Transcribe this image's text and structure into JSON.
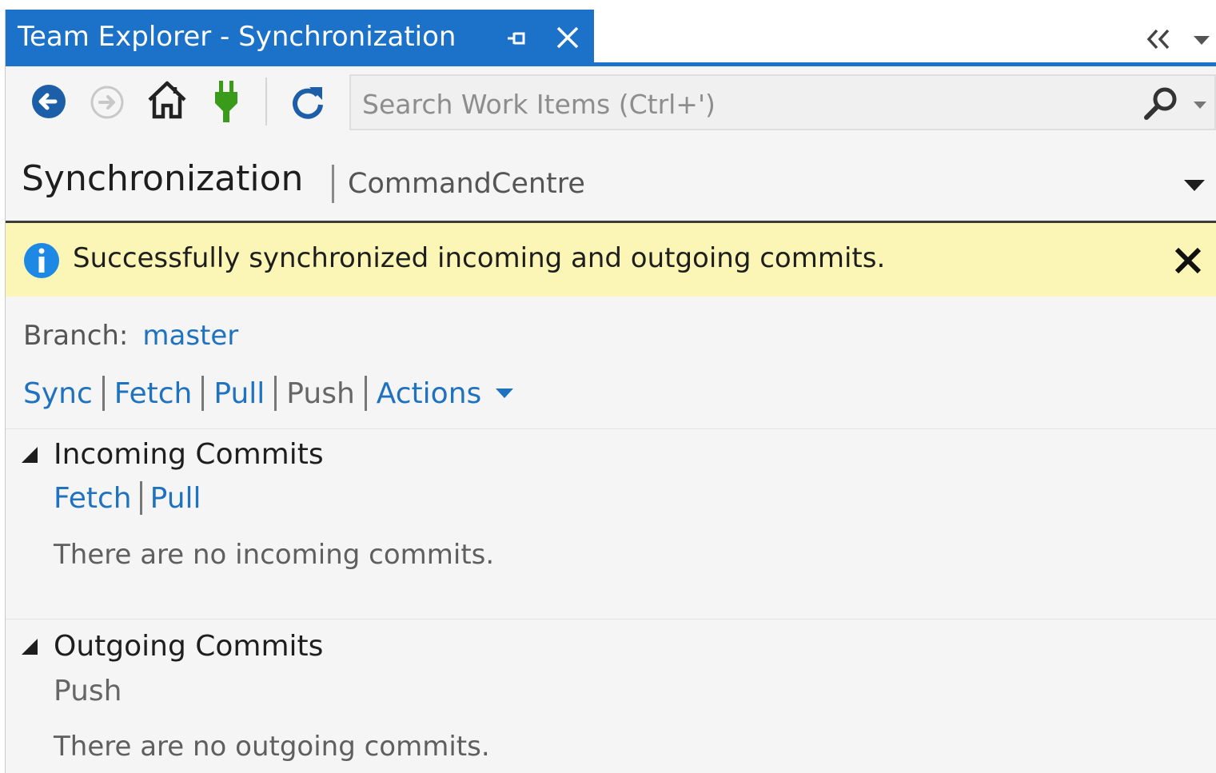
{
  "window": {
    "title": "Team Explorer - Synchronization"
  },
  "toolbar": {
    "icons": [
      "back-icon",
      "forward-icon",
      "home-icon",
      "connect-icon",
      "refresh-icon"
    ],
    "search_placeholder": "Search Work Items (Ctrl+')"
  },
  "page": {
    "title": "Synchronization",
    "context": "CommandCentre"
  },
  "notification": {
    "message": "Successfully synchronized incoming and outgoing commits."
  },
  "branch": {
    "label": "Branch:",
    "value": "master"
  },
  "actions": {
    "sync": "Sync",
    "fetch": "Fetch",
    "pull": "Pull",
    "push": "Push",
    "actions": "Actions"
  },
  "incoming": {
    "title": "Incoming Commits",
    "fetch": "Fetch",
    "pull": "Pull",
    "empty": "There are no incoming commits."
  },
  "outgoing": {
    "title": "Outgoing Commits",
    "push": "Push",
    "empty": "There are no outgoing commits."
  },
  "colors": {
    "accent": "#1c71c8",
    "link": "#1e72bf",
    "notification_bg": "#fbf6b5",
    "connect_icon": "#3a9a1a"
  }
}
